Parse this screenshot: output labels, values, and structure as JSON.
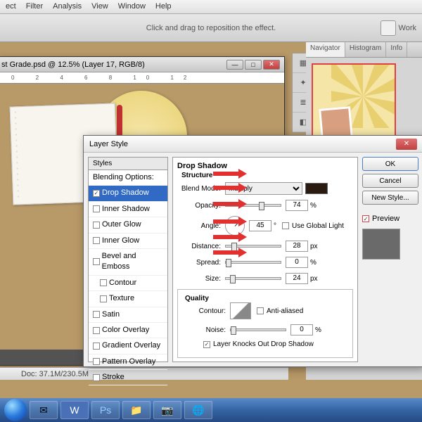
{
  "menu": {
    "items": [
      "ect",
      "Filter",
      "Analysis",
      "View",
      "Window",
      "Help"
    ]
  },
  "toolbar": {
    "hint": "Click and drag to reposition the effect.",
    "workspace_label": "Work"
  },
  "doc": {
    "title": "st Grade.psd @ 12.5% (Layer 17, RGB/8)",
    "status": "Doc: 37.1M/230.5M"
  },
  "panels": {
    "tabs": [
      "Navigator",
      "Histogram",
      "Info"
    ]
  },
  "dialog": {
    "title": "Layer Style",
    "styles_header": "Styles",
    "styles": [
      {
        "label": "Blending Options:",
        "kind": "blend"
      },
      {
        "label": "Drop Shadow",
        "kind": "sel",
        "checked": true
      },
      {
        "label": "Inner Shadow",
        "checked": false
      },
      {
        "label": "Outer Glow",
        "checked": false
      },
      {
        "label": "Inner Glow",
        "checked": false
      },
      {
        "label": "Bevel and Emboss",
        "checked": false
      },
      {
        "label": "Contour",
        "kind": "sub",
        "checked": false
      },
      {
        "label": "Texture",
        "kind": "sub",
        "checked": false
      },
      {
        "label": "Satin",
        "checked": false
      },
      {
        "label": "Color Overlay",
        "checked": false
      },
      {
        "label": "Gradient Overlay",
        "checked": false
      },
      {
        "label": "Pattern Overlay",
        "checked": false
      },
      {
        "label": "Stroke",
        "checked": false
      }
    ],
    "section": "Drop Shadow",
    "structure": "Structure",
    "blend_mode_label": "Blend Mode:",
    "blend_mode_value": "Multiply",
    "opacity_label": "Opacity:",
    "opacity_value": "74",
    "opacity_unit": "%",
    "angle_label": "Angle:",
    "angle_value": "45",
    "angle_unit": "°",
    "global_light": "Use Global Light",
    "distance_label": "Distance:",
    "distance_value": "28",
    "distance_unit": "px",
    "spread_label": "Spread:",
    "spread_value": "0",
    "spread_unit": "%",
    "size_label": "Size:",
    "size_value": "24",
    "size_unit": "px",
    "quality": "Quality",
    "contour_label": "Contour:",
    "antialiased": "Anti-aliased",
    "noise_label": "Noise:",
    "noise_value": "0",
    "noise_unit": "%",
    "knockout": "Layer Knocks Out Drop Shadow",
    "ok": "OK",
    "cancel": "Cancel",
    "new_style": "New Style...",
    "preview": "Preview"
  }
}
